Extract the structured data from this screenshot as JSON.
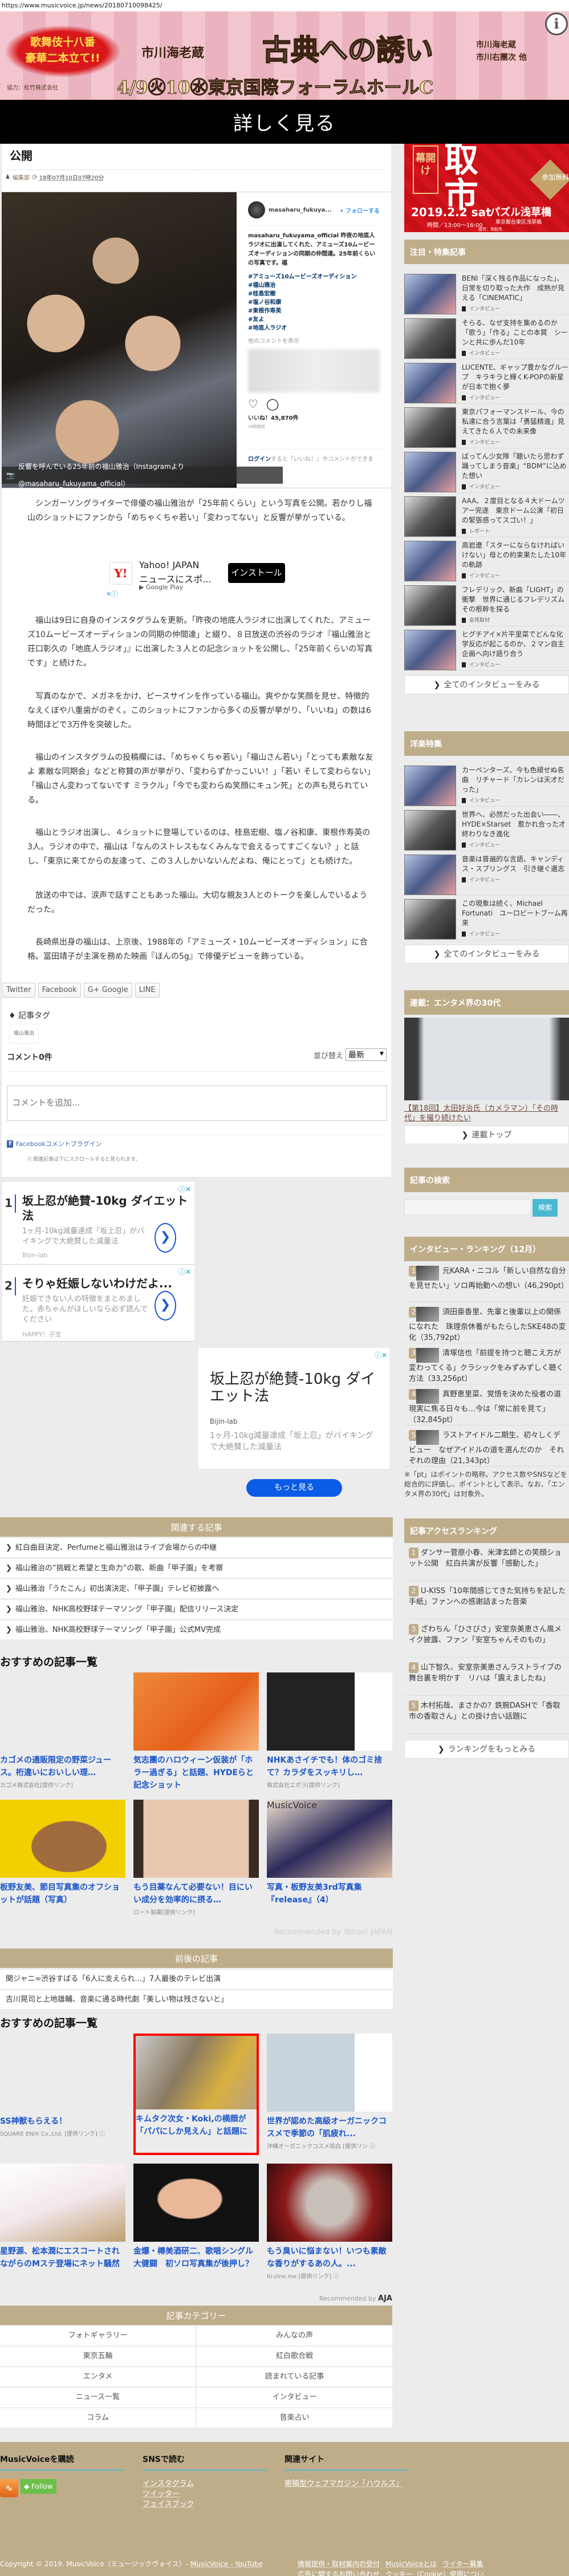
{
  "url": "https://www.musicvoice.jp/news/20180710098425/",
  "top_ad": {
    "badge": "歌舞伎十八番\n豪華二本立て!!",
    "actor": "市川海老蔵",
    "title": "古典への誘い",
    "cast": "市川海老蔵\n市川右團次 他",
    "date": "4/9㊋10㊌東京国際フォーラムホールC",
    "sponsor": "協力：松竹株式会社",
    "info_icon": "i"
  },
  "overlay_button": "詳しく見る",
  "side_ad": {
    "kaimaku": "幕開け",
    "city": "取市",
    "free": "参加無料",
    "date": "2019.2.2 sat",
    "time": "時間／13:00〜16:00",
    "venue": "パズル浅草橋",
    "address": "東京都台東区浅草橋",
    "provider": "提供：鳥取市"
  },
  "article": {
    "title_tail": "公開",
    "author": "編集部",
    "datetime": "18年07月10日07時20分",
    "instagram": {
      "username": "masaharu_fukuya...",
      "follow": "• フォローする",
      "caption": "masaharu_fukuyama_official 昨夜の地底人ラジオに出演してくれた、アミューズ10ムービーズオーディションの同期の仲間達。25年前くらいの写真です。福",
      "hashtags": [
        "#アミューズ10ムービーズオーディション",
        "#福山雅治",
        "#桂島宏樹",
        "#塩ノ谷和康",
        "#東根作寿英",
        "#友よ",
        "#地底人ラジオ"
      ],
      "more_comments": "他のコメントを表示",
      "likes": "いいね！45,870件",
      "time": "18時間前",
      "login_link": "ログイン",
      "login_text": "すると「いいね！」やコメントができま"
    },
    "photo_caption": "反響を呼んでいる25年前の福山雅治（Instagramより@masaharu_fukuyama_official）",
    "paragraphs": [
      "　シンガーソングライターで俳優の福山雅治が「25年前くらい」という写真を公開。若かりし福山のショットにファンから「めちゃくちゃ若い」「変わってない」と反響が挙がっている。",
      "　福山は9日に自身のインスタグラムを更新。「昨夜の地底人ラジオに出演してくれた、アミューズ10ムービーズオーディションの同期の仲間達」と綴り、８日放送の渋谷のラジオ『福山雅治と荘口彰久の「地底人ラジオ」』に出演した３人との記念ショットを公開し、「25年前くらいの写真です」と続けた。",
      "　写真のなかで、メガネをかけ、ピースサインを作っている福山。爽やかな笑顔を見せ、特徴的なえくぼや八重歯がのぞく。このショットにファンから多くの反響が挙がり、「いいね」の数は6時間ほどで3万件を突破した。",
      "　福山のインスタグラムの投稿欄には、「めちゃくちゃ若い」「福山さん若い」「とっても素敵な友よ 素敵な同期会」などと称賛の声が挙がり、「変わらずかっこいい！」「若い そして変わらない」「福山さん変わってないです ミラクル」「今でも変わらぬ笑顔にキュン死」との声も見られている。",
      "　福山とラジオ出演し、４ショットに登場しているのは、桂島宏樹、塩ノ谷和康、東根作寿英の3人。ラジオの中で、福山は「なんのストレスもなくみんなで会えるってすごくない？」と話し、「東京に来てからの友達って、この３人しかいないんだよね、俺にとって」とも続けた。",
      "　放送の中では、涙声で話すこともあった福山。大切な親友3人とのトークを楽しんでいるようだった。",
      "　長崎県出身の福山は、上京後、1988年の「アミューズ・10ムービーズオーディション」に合格。冨田靖子が主演を務めた映画『ほんの5g』で俳優デビューを飾っている。"
    ],
    "yahoo_ad": {
      "icon": "Y!",
      "title": "Yahoo! JAPAN",
      "subtitle": "ニュースにスポ...",
      "store": "▶ Google Play",
      "button": "インストール",
      "controls": "✕ⓘ"
    },
    "share": [
      "Twitter",
      "Facebook",
      "G+ Google",
      "LINE"
    ],
    "tags_heading": "記事タグ",
    "tags": [
      "福山雅治"
    ],
    "comments": {
      "count": "コメント0件",
      "sort_label": "並び替え",
      "sort_value": "最新",
      "placeholder": "コメントを追加...",
      "plugin": "Facebookコメントプラグイン"
    },
    "scroll_note": "関連記事は下にスクロールすると見られます。"
  },
  "ads": [
    {
      "num": "1",
      "title": "坂上忍が絶賛-10kg ダイエット法",
      "desc": "1ヶ月-10kg減量達成「坂上忍」がバイキングで大絶賛した減量法",
      "source": "Bijin-lab"
    },
    {
      "num": "2",
      "title": "そりゃ妊娠しないわけだよ...",
      "desc": "妊娠できない人の特徴をまとめました。赤ちゃんがほしいなら必ず読んでください",
      "source": "HAPPY！子宝"
    }
  ],
  "ad3": {
    "title": "坂上忍が絶賛-10kg ダイエット法",
    "source": "Bijin-lab",
    "desc": "1ヶ月-10kg減量達成「坂上忍」がバイキングで大絶賛した減量法",
    "button": "もっと見る"
  },
  "related": {
    "heading": "関連する記事",
    "items": [
      "紅白曲目決定、Perfumeと福山雅治はライブ会場からの中継",
      "福山雅治の“挑戦と希望と生命力”の歌、新曲「甲子園」を考察",
      "福山雅治「うたこん」初出演決定、「甲子園」テレビ初披露へ",
      "福山雅治、NHK高校野球テーマソング「甲子園」配信リリース決定",
      "福山雅治、NHK高校野球テーマソング「甲子園」公式MV完成"
    ]
  },
  "recommend1": {
    "heading": "おすすめの記事一覧",
    "cards": [
      {
        "title": "カゴメの通販限定の野菜ジュース。桁違いにおいしい理…",
        "source": "カゴメ株式会社[提供リンク]"
      },
      {
        "title": "気志團のハロウィーン仮装が「ホラー過ぎる」と話題、HYDEらと記念ショット"
      },
      {
        "title": "NHKあさイチでも！体のゴミ捨て？カラダをスッキリし…",
        "source": "株式会社エポラ[提供リンク]"
      },
      {
        "title": "板野友美、節目写真集のオフショットが話題（写真）"
      },
      {
        "title": "もう目薬なんて必要ない！目にいい成分を効率的に摂る…",
        "source": "ロート製薬[提供リンク]"
      },
      {
        "title": "写真・板野友美3rd写真集『release』（4）",
        "logo": "MusicVoice"
      }
    ],
    "recommended_by": "Recommended by Yahoo! JAPAN"
  },
  "prevnext": {
    "heading": "前後の記事",
    "items": [
      "関ジャニ∞渋谷すばる「6人に支えられ...」7人最後のテレビ出演",
      "吉川晃司と上地雄輔、音楽に通る時代劇「美しい物は残さないと」"
    ]
  },
  "recommend2": {
    "heading": "おすすめの記事一覧",
    "cards": [
      {
        "title": "SS神獣もらえる！",
        "source": "SQUARE ENIX Co.,Ltd. [提供リンク] ⓘ"
      },
      {
        "title": "キムタク次女・Koki,の横顔が「パパにしか見えん」と話題に"
      },
      {
        "title": "世界が認めた高級オーガニックコスメで季節の「肌疲れ...",
        "source": "沖縄オーガニックコスメ琉白 [提供リン ⓘ"
      },
      {
        "title": "星野源、松本潤にエスコートされながらのMステ登場にネット騒然"
      },
      {
        "title": "金爆・樽美酒研二、歌唱シングル大健闘　初ソロ写真集が後押し？"
      },
      {
        "title": "もう臭いに悩まない！いつも素敵な香りがするあの人。...",
        "source": "bi-zine.me [提供リンク] ⓘ"
      }
    ],
    "recommended_by": "Recommended by",
    "logo": "AJA"
  },
  "categories": {
    "heading": "記事カテゴリー",
    "items": [
      "フォトギャラリー",
      "みんなの声",
      "東京五輪",
      "紅白歌合戦",
      "エンタメ",
      "読まれている記事",
      "ニュース一覧",
      "インタビュー",
      "コラム",
      "音楽占い"
    ]
  },
  "sidebar": {
    "featured": {
      "heading": "注目・特集記事",
      "items": [
        {
          "title": "BENI「深く残る作品になった」、日常を切り取った大作　成熟が見える「CINEMATIC」",
          "category": "インタビュー"
        },
        {
          "title": "そらる、なぜ支持を集めるのか「歌う」「作る」ことの本質　シーンと共に歩んだ10年",
          "category": "インタビュー"
        },
        {
          "title": "LUCENTE、ギャップ豊かなグループ　キラキラと輝くK-POPの新星が日本で抱く夢",
          "category": "インタビュー"
        },
        {
          "title": "東京パフォーマンスドール、今の私達に合う言葉は「勇猛精進」見えてきた６人での未来像",
          "category": "インタビュー"
        },
        {
          "title": "ばってん少女隊「聴いたら思わず踊ってしまう音楽」“BDM”に込めた想い",
          "category": "インタビュー"
        },
        {
          "title": "AAA、２度目となる４大ドームツアー完遂　東京ドーム公演「初日の緊張感ってスゴい！」",
          "category": "レポート"
        },
        {
          "title": "高岩遼「スターにならなければいけない」母との約束果たした10年の軌跡",
          "category": "インタビュー"
        },
        {
          "title": "フレデリック、新曲「LIGHT」の衝撃　世界に通じるフレデリズム　その根幹を探る",
          "category": "会見取材"
        },
        {
          "title": "ヒグチアイ×片平里菜でどんな化学反応が起こるのか、２マン自主企画へ向け語り合う",
          "category": "インタビュー"
        }
      ],
      "button": "全てのインタビューをみる"
    },
    "western": {
      "heading": "洋楽特集",
      "items": [
        {
          "title": "カーペンターズ、今も色褪せぬ名曲　リチャード「カレンは天才だった」",
          "category": "インタビュー"
        },
        {
          "title": "世界へ、必然だった出会い――、HYDE×Starset　惹かれ合った才　終わりなき進化",
          "category": "インタビュー"
        },
        {
          "title": "音楽は普遍的な言語、キャンディス・スプリングス　引き継ぐ遺志",
          "category": "インタビュー"
        },
        {
          "title": "この現象は続く、Michael Fortunati　ユーロビートブーム再来",
          "category": "インタビュー"
        }
      ],
      "button": "全てのインタビューをみる"
    },
    "series": {
      "heading": "連載：エンタメ界の30代",
      "link": "【第18回】太田好治氏（カメラマン）「その時代」を撮り続けたい",
      "button": "連載トップ"
    },
    "search": {
      "heading": "記事の検索",
      "placeholder": "",
      "button": "検索"
    },
    "interview_ranking": {
      "heading": "インタビュー・ランキング（12月）",
      "items": [
        {
          "rank": "1",
          "title": "元KARA・ニコル「新しい自然な自分を見せたい」ソロ再始動への想い（46,290pt）"
        },
        {
          "rank": "2",
          "title": "須田亜香里、先輩と後輩以上の関係になれた　珠理奈休養がもたらしたSKE48の変化（35,792pt）"
        },
        {
          "rank": "3",
          "title": "清塚信也「前提を持つと聴こえ方が変わってくる」クラシックをみずみずしく聴く方法（33,256pt）"
        },
        {
          "rank": "4",
          "title": "真野恵里菜、覚悟を決めた役者の道　現実に焦る日々も…今は「常に前を見て」（32,845pt）"
        },
        {
          "rank": "5",
          "title": "ラストアイドル二期生、初々しくデビュー　なぜアイドルの道を選んだのか　それぞれの理由（21,343pt）"
        }
      ],
      "note": "※「pt」はポイントの略称。アクセス数やSNSなどを総合的に評価し、ポイントとして表示。なお、「エンタメ界の30代」は対象外。"
    },
    "access_ranking": {
      "heading": "記事アクセスランキング",
      "items": [
        {
          "rank": "1",
          "title": "ダンサー菅原小春、米津玄師との笑顔ショット公開　紅白共演が反響「感動した」"
        },
        {
          "rank": "2",
          "title": "U-KISS「10年間感じてきた気持ちを記した手紙」ファンへの感謝詰まった音楽"
        },
        {
          "rank": "3",
          "title": "ざわちん「ひさびさ」安室奈美恵さん風メイク披露、ファン「安室ちゃんそのもの」"
        },
        {
          "rank": "4",
          "title": "山下智久、安室奈美恵さんラストライブの舞台裏を明かす　リハは「震えましたね」"
        },
        {
          "rank": "5",
          "title": "木村拓哉、まさかの？鉄腕DASHで「香取市の香取さん」との掛け合い話題に"
        }
      ],
      "button": "ランキングをもっとみる"
    }
  },
  "footer": {
    "subscribe": {
      "heading": "MusicVoiceを購読",
      "follow": "◆ Follow"
    },
    "sns": {
      "heading": "SNSで読む",
      "links": [
        "インスタグラム",
        "ツイッター",
        "フェイスブック"
      ]
    },
    "related_sites": {
      "heading": "関連サイト",
      "links": [
        "寄稿型ウェブマガジン「ハウルズ」"
      ]
    },
    "copyright": "Copyright © 2019. MusicVoice（ミュージックヴォイス）-",
    "youtube_link": "MusicVoice - YouTube",
    "links": [
      "情報提供・取材案内の受付",
      "MusicVoiceとは",
      "ライター募集",
      "広告に関するお問い合わせ",
      "クッキー（Cookie）使用について"
    ]
  },
  "colors": {
    "accent_tan": "#bfad8a",
    "link_blue": "#1a55c8",
    "background": "#ececec"
  }
}
